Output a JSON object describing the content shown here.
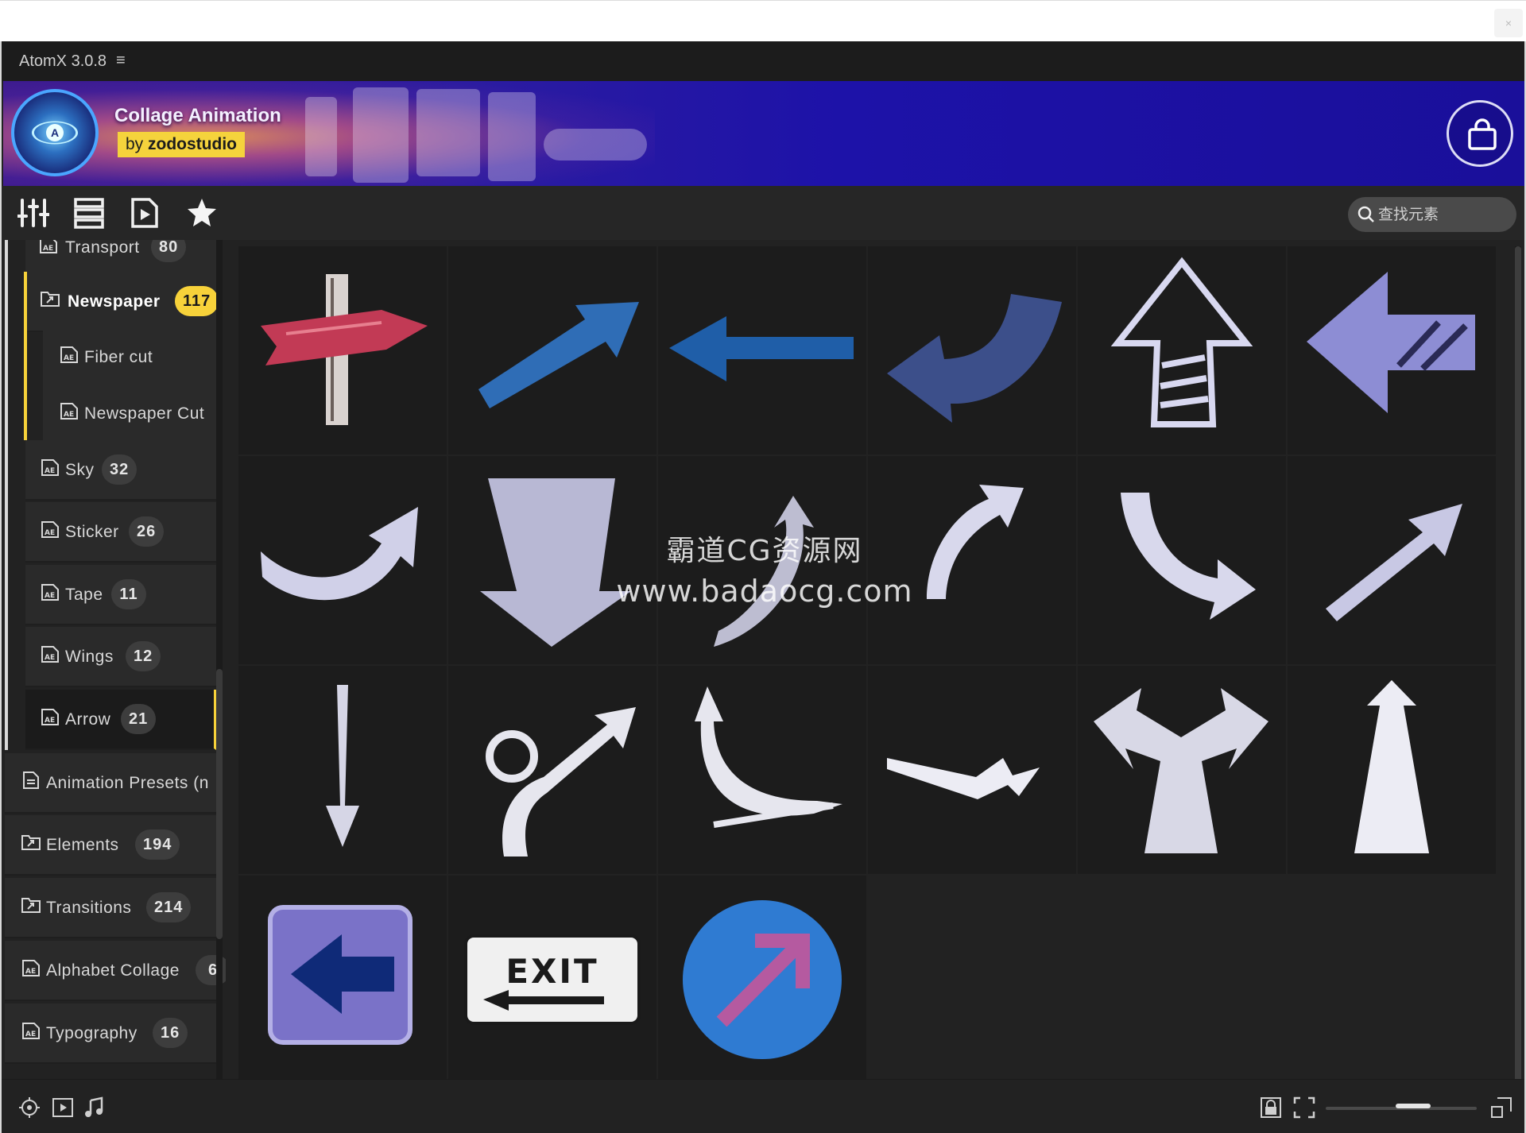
{
  "window": {
    "close_glyph": "×"
  },
  "app": {
    "title": "AtomX 3.0.8",
    "menu_glyph": "≡"
  },
  "banner": {
    "title": "Collage Animation",
    "by_prefix": "by",
    "by_author": "zodostudio"
  },
  "search": {
    "placeholder": "查找元素"
  },
  "sidebar": {
    "items": [
      {
        "label": "Transport",
        "count": "80",
        "icon": "ae-file-icon"
      },
      {
        "label": "Newspaper",
        "count": "117",
        "icon": "folder-link-icon",
        "selected": true
      },
      {
        "label": "Fiber cut",
        "icon": "ae-file-icon"
      },
      {
        "label": "Newspaper Cut",
        "icon": "ae-file-icon"
      },
      {
        "label": "Sky",
        "count": "32",
        "icon": "ae-file-icon"
      },
      {
        "label": "Sticker",
        "count": "26",
        "icon": "ae-file-icon"
      },
      {
        "label": "Tape",
        "count": "11",
        "icon": "ae-file-icon"
      },
      {
        "label": "Wings",
        "count": "12",
        "icon": "ae-file-icon"
      },
      {
        "label": "Arrow",
        "count": "21",
        "icon": "ae-file-icon",
        "active": true
      },
      {
        "label": "Animation Presets (n",
        "icon": "document-icon"
      },
      {
        "label": "Elements",
        "count": "194",
        "icon": "folder-link-icon"
      },
      {
        "label": "Transitions",
        "count": "214",
        "icon": "folder-link-icon"
      },
      {
        "label": "Alphabet Collage",
        "count": "6",
        "icon": "ae-file-icon"
      },
      {
        "label": "Typography",
        "count": "16",
        "icon": "ae-file-icon"
      }
    ]
  },
  "grid": {
    "exit_sign_text": "EXIT",
    "thumbnails": [
      "wooden-signpost-arrow",
      "blue-diagonal-arrow",
      "blue-left-arrow",
      "curved-left-arrow",
      "chalk-up-arrow",
      "chalk-left-arrow",
      "chalk-curved-right-arrow",
      "chalk-down-arrow",
      "chalk-curl-arrow",
      "chalk-up-curve-arrow",
      "chalk-down-curve-arrow",
      "chalk-diagonal-arrow",
      "thin-down-arrow",
      "loop-arrow",
      "s-curve-arrow",
      "zigzag-right-arrow",
      "split-arrow",
      "tall-up-arrow",
      "blue-left-sign",
      "exit-sign",
      "round-blue-sign"
    ]
  },
  "watermark": {
    "line1": "霸道CG资源网",
    "line2": "www.badaocg.com"
  },
  "colors": {
    "accent": "#f7d23a",
    "banner": "#1d12a8",
    "panel": "#222222"
  }
}
